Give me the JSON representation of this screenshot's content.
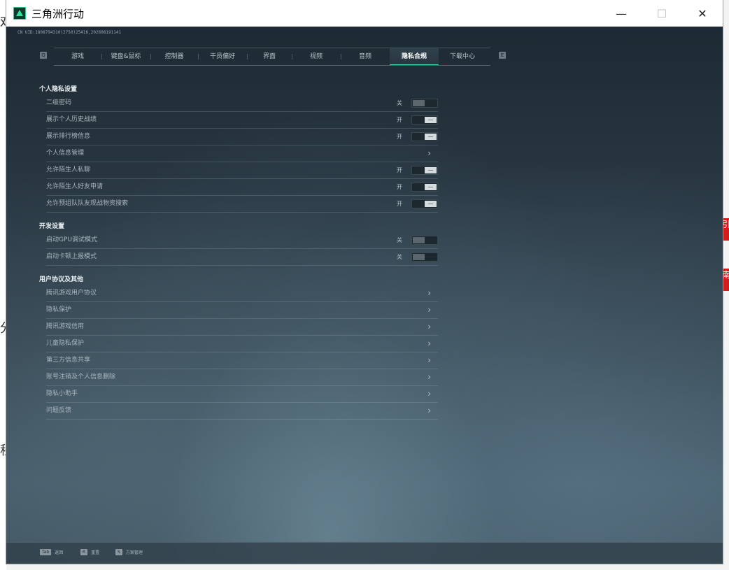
{
  "window": {
    "title": "三角洲行动",
    "minimize": "—",
    "maximize": "☐",
    "close": "✕"
  },
  "build_info": "CN UID:1808794310(2750)25416,202608191141",
  "tabs": {
    "prev_key": "Q",
    "next_key": "E",
    "items": [
      {
        "label": "游戏"
      },
      {
        "label": "键盘&鼠标"
      },
      {
        "label": "控制器"
      },
      {
        "label": "干员偏好"
      },
      {
        "label": "界面"
      },
      {
        "label": "视频"
      },
      {
        "label": "音频"
      },
      {
        "label": "隐私合规",
        "active": true
      },
      {
        "label": "下载中心"
      }
    ]
  },
  "sections": {
    "privacy": {
      "title": "个人隐私设置",
      "rows": [
        {
          "label": "二级密码",
          "state": "关",
          "kind": "off"
        },
        {
          "label": "展示个人历史战绩",
          "state": "开",
          "kind": "on"
        },
        {
          "label": "展示排行榜信息",
          "state": "开",
          "kind": "on"
        },
        {
          "label": "个人信息管理",
          "kind": "link"
        },
        {
          "label": "允许陌生人私聊",
          "state": "开",
          "kind": "on"
        },
        {
          "label": "允许陌生人好友申请",
          "state": "开",
          "kind": "on"
        },
        {
          "label": "允许预组队队友观战物资搜索",
          "state": "开",
          "kind": "on"
        }
      ]
    },
    "dev": {
      "title": "开发设置",
      "rows": [
        {
          "label": "启动GPU调试模式",
          "state": "关",
          "kind": "off"
        },
        {
          "label": "启动卡顿上报模式",
          "state": "关",
          "kind": "off"
        }
      ]
    },
    "agreements": {
      "title": "用户协议及其他",
      "rows": [
        {
          "label": "腾讯游戏用户协议",
          "kind": "link"
        },
        {
          "label": "隐私保护",
          "kind": "link"
        },
        {
          "label": "腾讯游戏信用",
          "kind": "link"
        },
        {
          "label": "儿童隐私保护",
          "kind": "link"
        },
        {
          "label": "第三方信息共享",
          "kind": "link"
        },
        {
          "label": "账号注销及个人信息删除",
          "kind": "link"
        },
        {
          "label": "隐私小助手",
          "kind": "link"
        },
        {
          "label": "问题反馈",
          "kind": "link"
        }
      ]
    }
  },
  "chevron": "›",
  "bottom_hints": [
    {
      "key": "Tab",
      "label": "返回"
    },
    {
      "key": "R",
      "label": "重置"
    },
    {
      "key": "S",
      "label": "方案管理"
    }
  ],
  "background_app": {
    "glyph_1": "戏",
    "glyph_2": "分",
    "glyph_3": "程",
    "red_1": "引",
    "red_2": "南"
  },
  "colors": {
    "accent": "#3be0a0",
    "toggle_on": "#d5dcdf",
    "toggle_off": "#5b666d"
  }
}
